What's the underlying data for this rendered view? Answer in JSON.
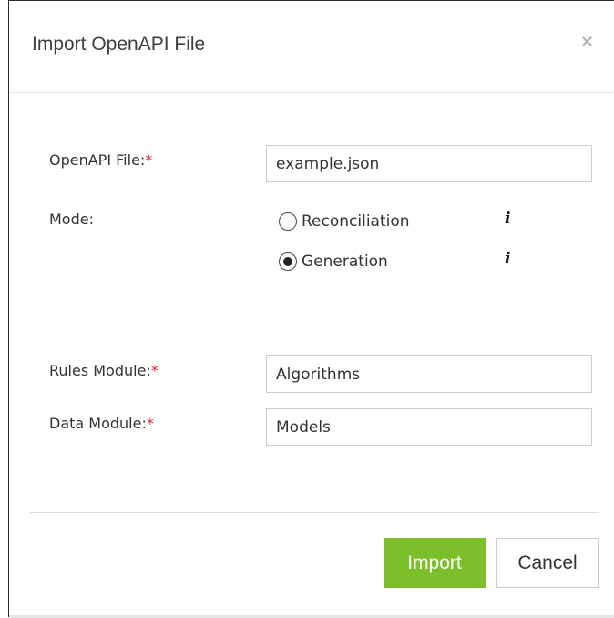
{
  "dialog": {
    "title": "Import OpenAPI File",
    "close_icon": "close-icon",
    "close_glyph": "✕"
  },
  "form": {
    "openapi_file": {
      "label": "OpenAPI File:",
      "required_mark": "*",
      "value": "example.json"
    },
    "mode": {
      "label": "Mode:",
      "options": [
        {
          "label": "Reconciliation",
          "selected": false,
          "info_icon": "info-icon",
          "info_glyph": "i"
        },
        {
          "label": "Generation",
          "selected": true,
          "info_icon": "info-icon",
          "info_glyph": "i"
        }
      ]
    },
    "rules_module": {
      "label": "Rules Module:",
      "required_mark": "*",
      "value": "Algorithms"
    },
    "data_module": {
      "label": "Data Module:",
      "required_mark": "*",
      "value": "Models"
    }
  },
  "footer": {
    "import_label": "Import",
    "cancel_label": "Cancel"
  },
  "colors": {
    "primary": "#7cbf2a",
    "required": "#e0242a",
    "border": "#cccccc"
  }
}
